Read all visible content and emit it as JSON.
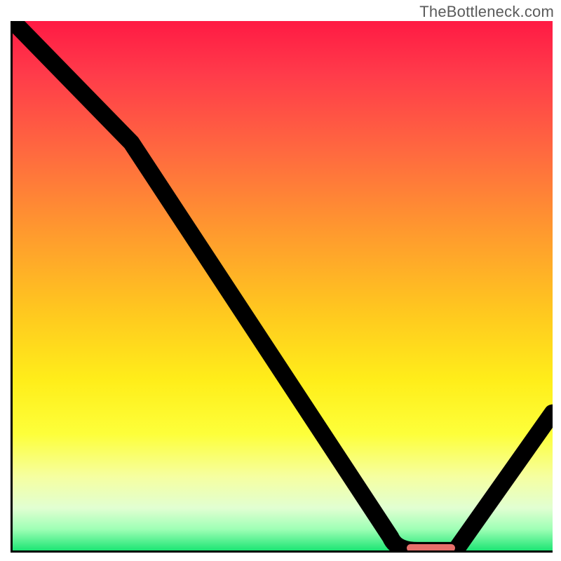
{
  "watermark": "TheBottleneck.com",
  "chart_data": {
    "type": "line",
    "title": "",
    "xlabel": "",
    "ylabel": "",
    "xlim": [
      0,
      100
    ],
    "ylim": [
      0,
      100
    ],
    "grid": false,
    "legend": false,
    "series": [
      {
        "name": "bottleneck-curve",
        "x": [
          0,
          22,
          70,
          75,
          82,
          100
        ],
        "values": [
          100,
          77,
          2.5,
          0,
          0,
          26
        ]
      }
    ],
    "marker": {
      "name": "optimal-range",
      "x_start": 73,
      "x_end": 82,
      "y": 0,
      "color": "#e76f6a"
    },
    "background": {
      "type": "vertical-gradient",
      "stops": [
        {
          "pos": 0,
          "color": "#ff1a44"
        },
        {
          "pos": 10,
          "color": "#ff3b4a"
        },
        {
          "pos": 25,
          "color": "#ff6a3f"
        },
        {
          "pos": 40,
          "color": "#ff9a2e"
        },
        {
          "pos": 55,
          "color": "#ffc81f"
        },
        {
          "pos": 68,
          "color": "#ffee1a"
        },
        {
          "pos": 78,
          "color": "#fdff3a"
        },
        {
          "pos": 86,
          "color": "#f6ffa0"
        },
        {
          "pos": 92,
          "color": "#e1ffd2"
        },
        {
          "pos": 96,
          "color": "#9effb5"
        },
        {
          "pos": 100,
          "color": "#1de574"
        }
      ]
    }
  }
}
